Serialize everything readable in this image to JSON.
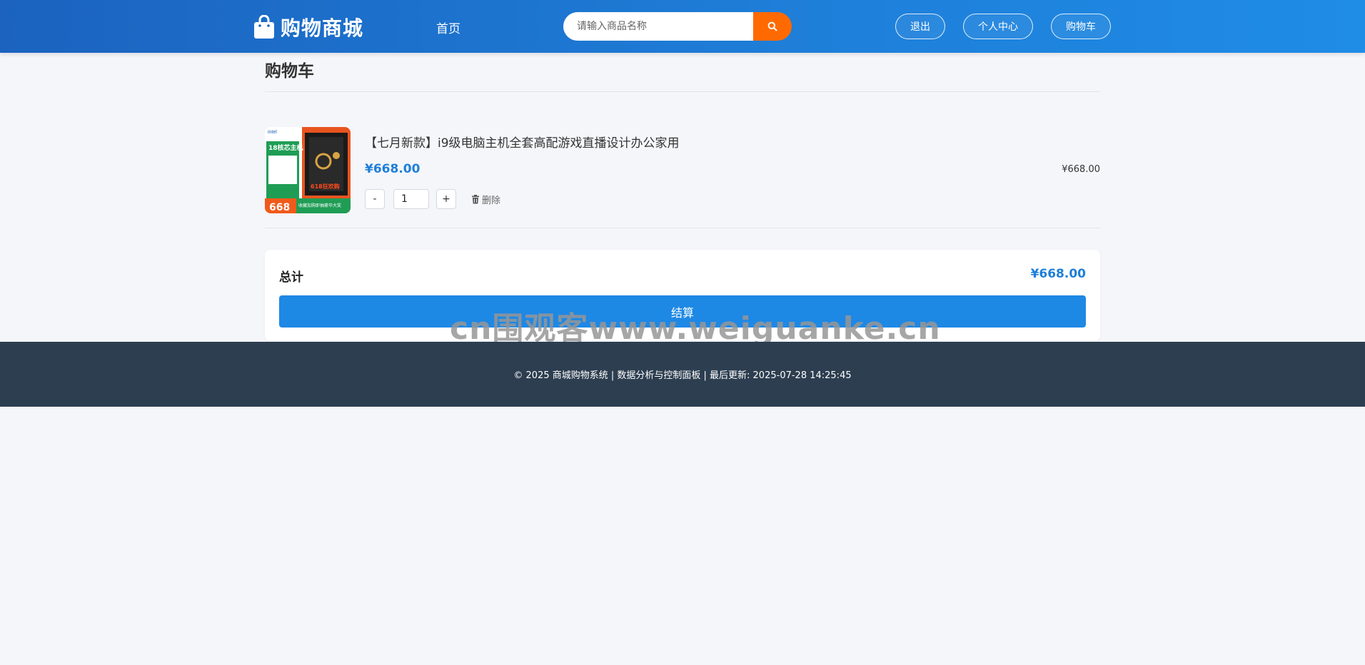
{
  "header": {
    "logo_text": "购物商城",
    "nav_home": "首页",
    "search_placeholder": "请输入商品名称",
    "buttons": {
      "logout": "退出",
      "profile": "个人中心",
      "cart": "购物车"
    }
  },
  "page": {
    "title": "购物车"
  },
  "cart": {
    "items": [
      {
        "name": "【七月新款】i9级电脑主机全套高配游戏直播设计办公家用",
        "price": "¥668.00",
        "quantity": "1",
        "subtotal": "¥668.00",
        "minus_label": "-",
        "plus_label": "+",
        "delete_label": "删除",
        "image_texts": {
          "brand": "intel",
          "headline": "18核芯主机",
          "promo": "618狂欢购",
          "price": "668",
          "banner": "收藏加购即抽豪华大奖"
        }
      }
    ]
  },
  "summary": {
    "label": "总计",
    "total": "¥668.00",
    "checkout_label": "结算"
  },
  "watermark": "cn围观客www.weiguanke.cn",
  "footer": {
    "text": "© 2025 商城购物系统 | 数据分析与控制面板 | 最后更新: 2025-07-28 14:25:45"
  },
  "colors": {
    "accent": "#1e7fd9",
    "search_button": "#ff6a00",
    "footer_bg": "#2d3e50"
  }
}
